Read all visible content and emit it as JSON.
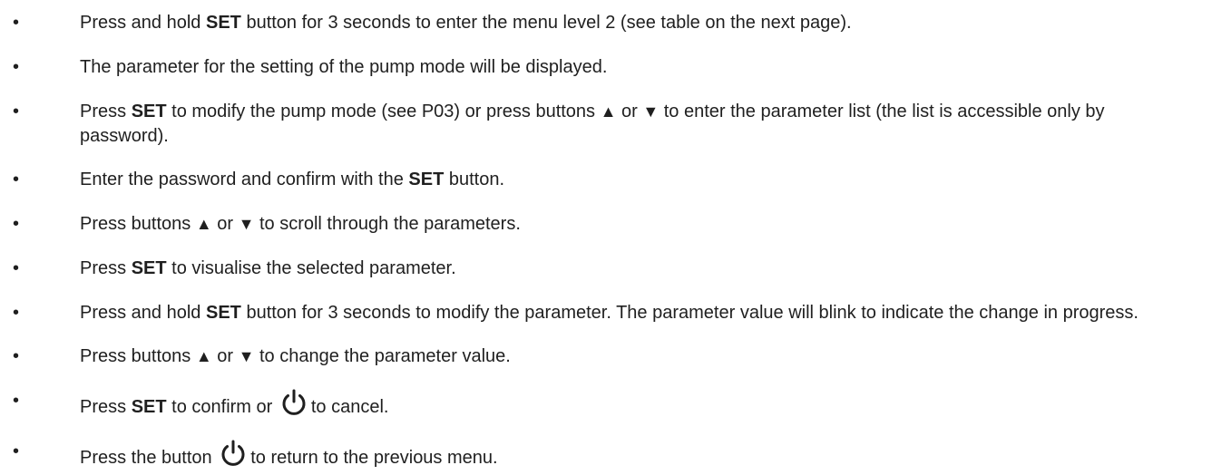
{
  "steps": [
    {
      "a": "Press and hold ",
      "b": "SET",
      "c": " button for 3 seconds to enter the menu level 2 (see table on the next page)."
    },
    {
      "a": "The parameter for the setting of the pump mode will be displayed."
    },
    {
      "a": "Press ",
      "b": "SET",
      "c": " to modify the pump mode (see P03) or press buttons ",
      "up": "▲",
      "or": " or ",
      "down": "▼",
      "d": " to enter the parameter list (the list is accessible only by password)."
    },
    {
      "a": "Enter the password and confirm with the ",
      "b": "SET",
      "c": " button."
    },
    {
      "a": "Press buttons ",
      "up": "▲",
      "or": " or ",
      "down": "▼",
      "c": " to scroll through the parameters."
    },
    {
      "a": "Press ",
      "b": "SET",
      "c": " to visualise the selected parameter."
    },
    {
      "a": "Press and hold ",
      "b": "SET",
      "c": " button for 3 seconds to modify the parameter. The parameter value will blink to indicate the change in progress."
    },
    {
      "a": "Press buttons ",
      "up": "▲",
      "or": " or ",
      "down": "▼",
      "c": " to change the parameter value."
    },
    {
      "a": "Press ",
      "b": "SET",
      "c": " to confirm or ",
      "icon": "power-icon",
      "d": "to cancel."
    },
    {
      "a": "Press the button ",
      "icon": "power-icon",
      "d": "to return to the previous menu."
    }
  ],
  "bullet": "•"
}
